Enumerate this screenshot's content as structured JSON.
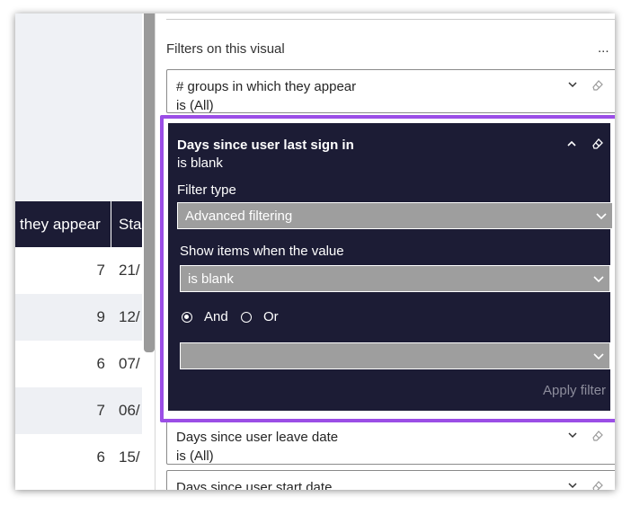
{
  "table": {
    "columns": [
      "they appear",
      "Sta"
    ],
    "rows": [
      {
        "count": "7",
        "date": "21/"
      },
      {
        "count": "9",
        "date": "12/"
      },
      {
        "count": "6",
        "date": "07/"
      },
      {
        "count": "7",
        "date": "06/"
      },
      {
        "count": "6",
        "date": "15/"
      }
    ]
  },
  "filter_pane": {
    "title": "Filters on this visual",
    "more_label": "...",
    "cards": [
      {
        "title": "# groups in which they appear",
        "summary": "is (All)"
      },
      {
        "title": "Days since user leave date",
        "summary": "is (All)"
      },
      {
        "title": "Days since user start date",
        "summary": ""
      }
    ],
    "active_filter": {
      "title": "Days since user last sign in",
      "summary": "is blank",
      "filter_type_label": "Filter type",
      "filter_type_value": "Advanced filtering",
      "show_items_label": "Show items when the value",
      "condition_value": "is blank",
      "logic": {
        "and_label": "And",
        "or_label": "Or",
        "selected": "And"
      },
      "second_condition_value": "",
      "apply_label": "Apply filter"
    }
  },
  "colors": {
    "accent": "#9b4ee6",
    "dark_bg": "#1c1c35",
    "dropdown_bg": "#9e9e9e",
    "apply_disabled": "#8d8d9c"
  }
}
